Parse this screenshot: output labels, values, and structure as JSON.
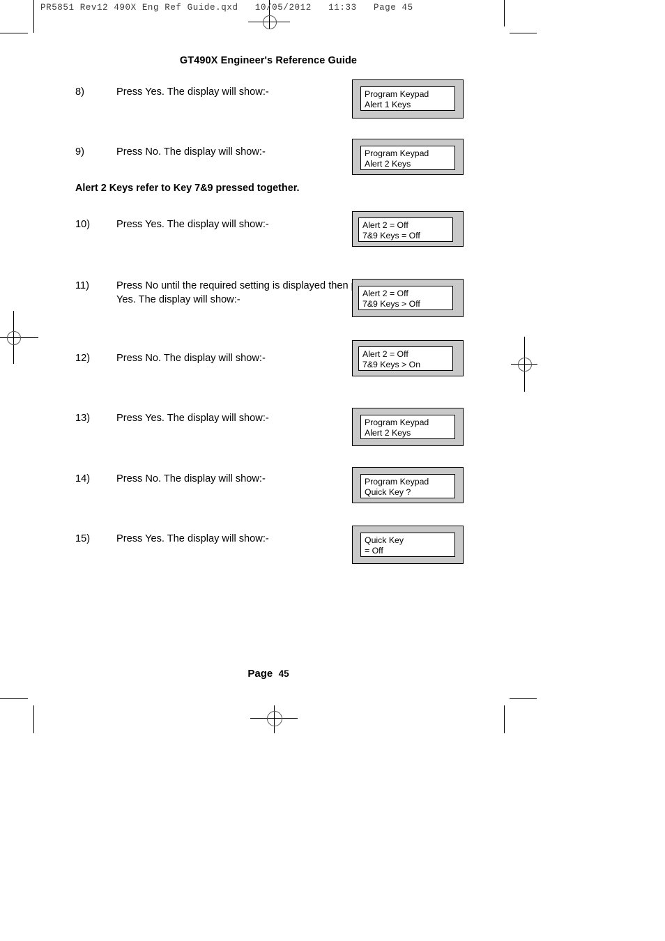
{
  "document": {
    "filestamp": "PR5851 Rev12 490X Eng Ref Guide.qxd   10/05/2012   11:33   Page 45",
    "running_head": "GT490X Engineer's Reference Guide",
    "footer_label": "Page",
    "footer_page_number": "45"
  },
  "colors": {
    "lcd_bezel": "#c9c9c9",
    "lcd_screen": "#ffffff",
    "ink": "#000000"
  },
  "note": {
    "text": "Alert 2 Keys refer to Key 7&9 pressed together."
  },
  "steps": [
    {
      "number": "8)",
      "text": "Press Yes. The display will show:-",
      "display": {
        "line1": "Program Keypad",
        "line2": "Alert 1 Keys"
      }
    },
    {
      "number": "9)",
      "text": "Press No. The display will show:-",
      "display": {
        "line1": "Program Keypad",
        "line2": "Alert 2 Keys"
      }
    },
    {
      "number": "10)",
      "text": "Press Yes. The display will show:-",
      "display": {
        "line1": "Alert 2 = Off",
        "line2": "7&9 Keys = Off"
      }
    },
    {
      "number": "11)",
      "text": "Press No until the required setting is displayed then press Yes. The display will show:-",
      "display": {
        "line1": "Alert 2 = Off",
        "line2": "7&9 Keys > Off"
      }
    },
    {
      "number": "12)",
      "text": "Press No. The display will show:-",
      "display": {
        "line1": "Alert 2 = Off",
        "line2": "7&9 Keys > On"
      }
    },
    {
      "number": "13)",
      "text": "Press Yes. The display will show:-",
      "display": {
        "line1": "Program Keypad",
        "line2": "Alert 2 Keys"
      }
    },
    {
      "number": "14)",
      "text": "Press No. The display will show:-",
      "display": {
        "line1": "Program Keypad",
        "line2": "Quick Key ?"
      }
    },
    {
      "number": "15)",
      "text": "Press Yes. The display will show:-",
      "display": {
        "line1": "Quick Key",
        "line2": "= Off"
      }
    }
  ]
}
